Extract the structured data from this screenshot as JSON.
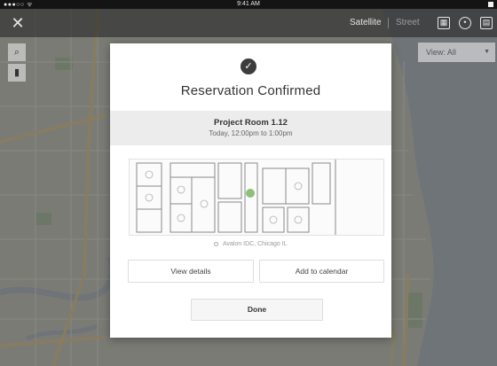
{
  "status_bar": {
    "signal": "●●●○○ ᯤ",
    "time": "9:41 AM"
  },
  "toolbar": {
    "close_symbol": "✕",
    "satellite_label": "Satellite",
    "street_label": "Street",
    "icons": [
      "calendar-icon",
      "location-icon",
      "layers-icon"
    ]
  },
  "side_controls": {
    "search_symbol": "⌕",
    "bookmark_symbol": "▮"
  },
  "view_filter": {
    "label": "View: All",
    "chevron": "▼"
  },
  "modal": {
    "check_symbol": "✓",
    "title": "Reservation Confirmed",
    "room_name": "Project Room 1.12",
    "room_time": "Today, 12:00pm to 1:00pm",
    "location": "Avalon IDC, Chicago IL",
    "view_details_label": "View details",
    "add_calendar_label": "Add to calendar",
    "done_label": "Done"
  },
  "colors": {
    "map_base": "#bfbfb6",
    "water": "#a9b3ba",
    "highlight_room": "#8fbf7a"
  }
}
